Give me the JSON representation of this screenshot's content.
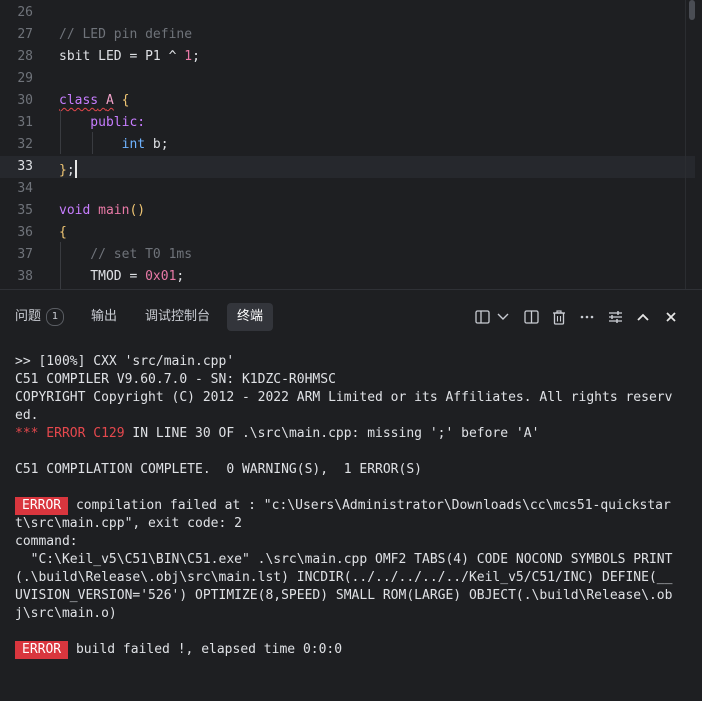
{
  "editor": {
    "lines": [
      {
        "num": "26"
      },
      {
        "num": "27",
        "tokens": [
          {
            "t": "// LED pin define",
            "c": "t-comment"
          }
        ]
      },
      {
        "num": "28",
        "tokens": [
          {
            "t": "sbit LED = P1 ^ ",
            "c": "t-plain"
          },
          {
            "t": "1",
            "c": "t-num"
          },
          {
            "t": ";",
            "c": "t-plain"
          }
        ]
      },
      {
        "num": "29"
      },
      {
        "num": "30",
        "tokens": [
          {
            "t": "class",
            "c": "t-kw squiggle"
          },
          {
            "t": " ",
            "c": "t-plain squiggle"
          },
          {
            "t": "A",
            "c": "t-class squiggle"
          },
          {
            "t": " ",
            "c": "t-plain"
          },
          {
            "t": "{",
            "c": "t-brace"
          }
        ]
      },
      {
        "num": "31",
        "tokens": [
          {
            "t": "    public:",
            "c": "t-kw"
          }
        ]
      },
      {
        "num": "32",
        "tokens": [
          {
            "t": "        ",
            "c": "t-plain"
          },
          {
            "t": "int",
            "c": "t-type"
          },
          {
            "t": " b;",
            "c": "t-plain"
          }
        ]
      },
      {
        "num": "33",
        "tokens": [
          {
            "t": "}",
            "c": "t-brace"
          },
          {
            "t": ";",
            "c": "t-plain"
          }
        ]
      },
      {
        "num": "34"
      },
      {
        "num": "35",
        "tokens": [
          {
            "t": "void",
            "c": "t-kw"
          },
          {
            "t": " ",
            "c": "t-plain"
          },
          {
            "t": "main",
            "c": "t-fn"
          },
          {
            "t": "()",
            "c": "t-brace"
          }
        ]
      },
      {
        "num": "36",
        "tokens": [
          {
            "t": "{",
            "c": "t-brace"
          }
        ]
      },
      {
        "num": "37",
        "tokens": [
          {
            "t": "    // set T0 1ms",
            "c": "t-comment"
          }
        ]
      },
      {
        "num": "38",
        "tokens": [
          {
            "t": "    TMOD = ",
            "c": "t-plain"
          },
          {
            "t": "0x01",
            "c": "t-num"
          },
          {
            "t": ";",
            "c": "t-plain"
          }
        ]
      }
    ],
    "current_line": "33"
  },
  "panel": {
    "tabs": [
      {
        "label": "问题",
        "badge": "1"
      },
      {
        "label": "输出"
      },
      {
        "label": "调试控制台"
      },
      {
        "label": "终端"
      }
    ],
    "active_tab": "终端",
    "toolbar_icons": [
      "split-terminal-icon",
      "chevron-down-icon",
      "split-editor-icon",
      "trash-icon",
      "more-icon",
      "settings-sliders-icon",
      "chevron-up-icon",
      "close-icon"
    ]
  },
  "terminal": {
    "lines": [
      {
        "text": ">> [100%] CXX 'src/main.cpp'"
      },
      {
        "text": "C51 COMPILER V9.60.7.0 - SN: K1DZC-R0HMSC"
      },
      {
        "text": "COPYRIGHT Copyright (C) 2012 - 2022 ARM Limited or its Affiliates. All rights reserv"
      },
      {
        "text": "ed."
      },
      {
        "err_prefix": "*** ERROR C129",
        "text": " IN LINE 30 OF .\\src\\main.cpp: missing ';' before 'A'"
      },
      {
        "text": ""
      },
      {
        "text": "C51 COMPILATION COMPLETE.  0 WARNING(S),  1 ERROR(S)"
      },
      {
        "text": ""
      },
      {
        "badge": "ERROR",
        "text": " compilation failed at : \"c:\\Users\\Administrator\\Downloads\\cc\\mcs51-quickstar"
      },
      {
        "text": "t\\src\\main.cpp\", exit code: 2"
      },
      {
        "text": "command:"
      },
      {
        "text": "  \"C:\\Keil_v5\\C51\\BIN\\C51.exe\" .\\src\\main.cpp OMF2 TABS(4) CODE NOCOND SYMBOLS PRINT"
      },
      {
        "text": "(.\\build\\Release\\.obj\\src\\main.lst) INCDIR(../../../../../Keil_v5/C51/INC) DEFINE(__"
      },
      {
        "text": "UVISION_VERSION='526') OPTIMIZE(8,SPEED) SMALL ROM(LARGE) OBJECT(.\\build\\Release\\.ob"
      },
      {
        "text": "j\\src\\main.o)"
      },
      {
        "text": ""
      },
      {
        "badge": "ERROR",
        "text": " build failed !, elapsed time 0:0:0"
      }
    ]
  }
}
